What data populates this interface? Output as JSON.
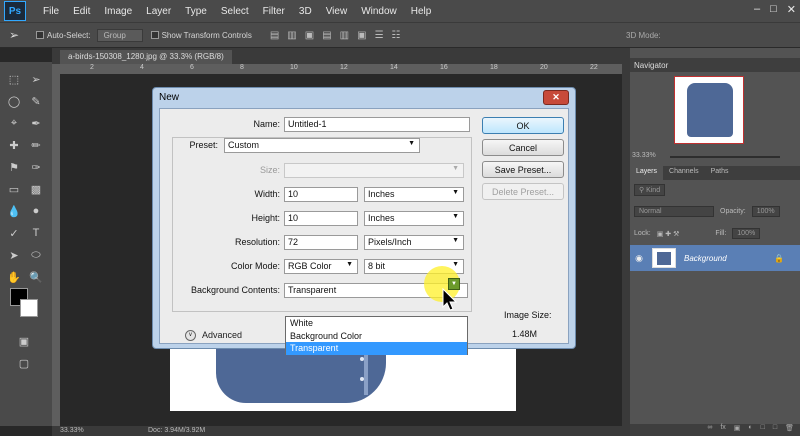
{
  "app": {
    "logo": "Ps",
    "menu": [
      "File",
      "Edit",
      "Image",
      "Layer",
      "Type",
      "Select",
      "Filter",
      "3D",
      "View",
      "Window",
      "Help"
    ]
  },
  "options_bar": {
    "auto_select_label": "Auto-Select:",
    "auto_select_value": "Group",
    "transform_label": "Show Transform Controls",
    "mode_3d": "3D Mode:"
  },
  "document": {
    "tab_title": "a-birds-150308_1280.jpg @ 33.3% (RGB/8)",
    "ruler_ticks": [
      "2",
      "4",
      "6",
      "8",
      "10",
      "12",
      "14",
      "16",
      "18",
      "20",
      "22"
    ],
    "status_zoom": "33.33%",
    "status_doc": "Doc: 3.94M/3.92M"
  },
  "navigator": {
    "title": "Navigator",
    "zoom": "33.33%"
  },
  "layers": {
    "tabs": [
      "Layers",
      "Channels",
      "Paths"
    ],
    "kind_label": "Kind",
    "blend_mode": "Normal",
    "opacity_label": "Opacity:",
    "opacity_value": "100%",
    "lock_label": "Lock:",
    "fill_label": "Fill:",
    "fill_value": "100%",
    "background_layer_name": "Background"
  },
  "dialog": {
    "title": "New",
    "name_label": "Name:",
    "name_value": "Untitled-1",
    "preset_label": "Preset:",
    "preset_value": "Custom",
    "size_label": "Size:",
    "width_label": "Width:",
    "width_value": "10",
    "width_unit": "Inches",
    "height_label": "Height:",
    "height_value": "10",
    "height_unit": "Inches",
    "resolution_label": "Resolution:",
    "resolution_value": "72",
    "resolution_unit": "Pixels/Inch",
    "color_mode_label": "Color Mode:",
    "color_mode_value": "RGB Color",
    "bit_depth_value": "8 bit",
    "bg_contents_label": "Background Contents:",
    "bg_contents_value": "Transparent",
    "bg_options": [
      "White",
      "Background Color",
      "Transparent"
    ],
    "advanced_label": "Advanced",
    "image_size_label": "Image Size:",
    "image_size_value": "1.48M",
    "ok_label": "OK",
    "cancel_label": "Cancel",
    "save_preset_label": "Save Preset...",
    "delete_preset_label": "Delete Preset..."
  },
  "colors": {
    "dialog_frame": "#bcd2ea",
    "selected_option": "#3399ff",
    "layer_selected": "#5a7fb5",
    "shirt": "#4e6896"
  }
}
